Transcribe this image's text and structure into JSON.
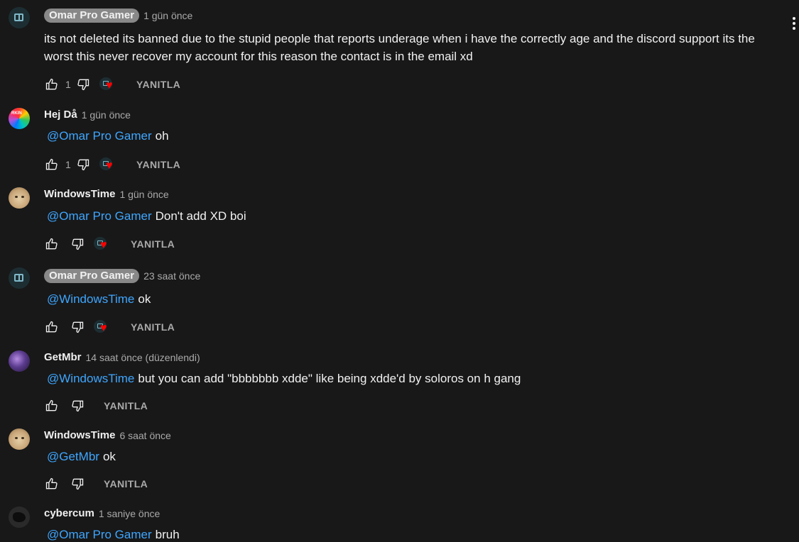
{
  "comments": [
    {
      "author": "Omar Pro Gamer",
      "time": "1 gün önce",
      "mention": "",
      "text": "its not deleted its banned due to the stupid people that reports underage when i have the correctly age and the discord support its the worst this never recover my account for this reason the contact is in the email xd",
      "likes": "1",
      "reply_label": "YANITLA"
    },
    {
      "author": "Hej Då",
      "time": "1 gün önce",
      "mention": "@Omar Pro Gamer",
      "text": "oh",
      "likes": "1",
      "reply_label": "YANITLA",
      "avatar_text": "RKIN"
    },
    {
      "author": "WindowsTime",
      "time": "1 gün önce",
      "mention": "@Omar Pro Gamer",
      "text": "Don't add XD boi",
      "likes": "",
      "reply_label": "YANITLA"
    },
    {
      "author": "Omar Pro Gamer",
      "time": "23 saat önce",
      "mention": "@WindowsTime",
      "text": "ok",
      "likes": "",
      "reply_label": "YANITLA"
    },
    {
      "author": "GetMbr",
      "time": "14 saat önce (düzenlendi)",
      "mention": "@WindowsTime",
      "text": "but you can add \"bbbbbbb xdde\" like being xdde'd by soloros on h gang",
      "likes": "",
      "reply_label": "YANITLA"
    },
    {
      "author": "WindowsTime",
      "time": "6 saat önce",
      "mention": "@GetMbr",
      "text": "ok",
      "likes": "",
      "reply_label": "YANITLA"
    },
    {
      "author": "cybercum",
      "time": "1 saniye önce",
      "mention": "@Omar Pro Gamer",
      "text": "bruh",
      "likes": "",
      "reply_label": "YANITLA"
    }
  ],
  "colors": {
    "background": "#181818",
    "mention": "#3ea6ff",
    "heart": "#ff0000",
    "chip": "#888888"
  },
  "icons": [
    "thumbs-up-icon",
    "thumbs-down-icon",
    "heart-icon",
    "more-vert-icon"
  ]
}
